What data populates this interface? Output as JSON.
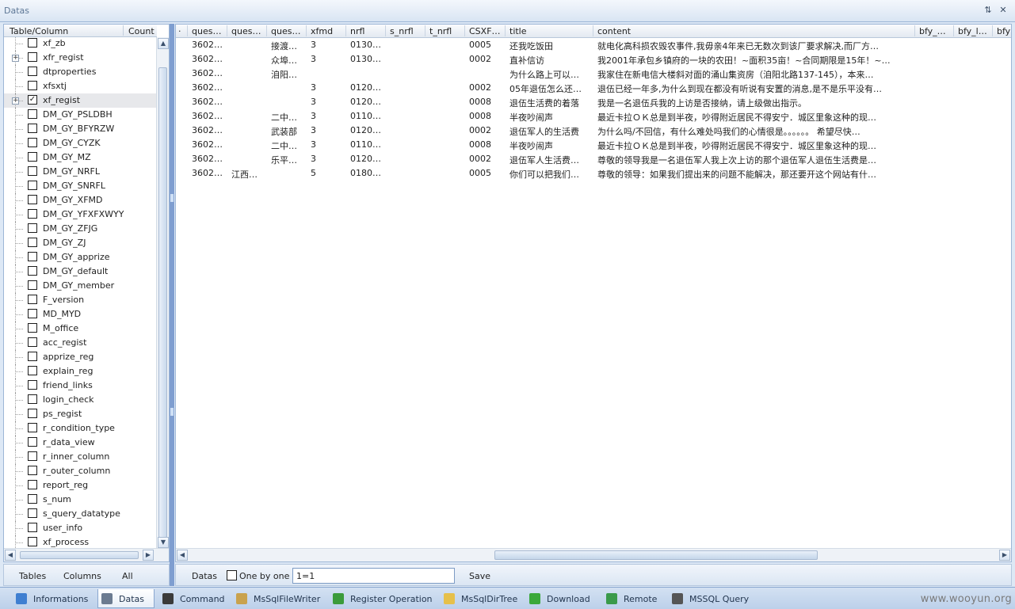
{
  "window": {
    "title": "Datas",
    "pin_icon": "pin-icon",
    "close_icon": "close-icon"
  },
  "tree": {
    "header_table": "Table/Column",
    "header_count": "Count",
    "items": [
      {
        "label": "xf_zb",
        "checked": false,
        "expandable": false
      },
      {
        "label": "xfr_regist",
        "checked": false,
        "expandable": true
      },
      {
        "label": "dtproperties",
        "checked": false,
        "expandable": false
      },
      {
        "label": "xfsxtj",
        "checked": false,
        "expandable": false
      },
      {
        "label": "xf_regist",
        "checked": true,
        "expandable": true,
        "selected": true
      },
      {
        "label": "DM_GY_PSLDBH",
        "checked": false,
        "expandable": false
      },
      {
        "label": "DM_GY_BFYRZW",
        "checked": false,
        "expandable": false
      },
      {
        "label": "DM_GY_CYZK",
        "checked": false,
        "expandable": false
      },
      {
        "label": "DM_GY_MZ",
        "checked": false,
        "expandable": false
      },
      {
        "label": "DM_GY_NRFL",
        "checked": false,
        "expandable": false
      },
      {
        "label": "DM_GY_SNRFL",
        "checked": false,
        "expandable": false
      },
      {
        "label": "DM_GY_XFMD",
        "checked": false,
        "expandable": false
      },
      {
        "label": "DM_GY_YFXFXWYY",
        "checked": false,
        "expandable": false
      },
      {
        "label": "DM_GY_ZFJG",
        "checked": false,
        "expandable": false
      },
      {
        "label": "DM_GY_ZJ",
        "checked": false,
        "expandable": false
      },
      {
        "label": "DM_GY_apprize",
        "checked": false,
        "expandable": false
      },
      {
        "label": "DM_GY_default",
        "checked": false,
        "expandable": false
      },
      {
        "label": "DM_GY_member",
        "checked": false,
        "expandable": false
      },
      {
        "label": "F_version",
        "checked": false,
        "expandable": false
      },
      {
        "label": "MD_MYD",
        "checked": false,
        "expandable": false
      },
      {
        "label": "M_office",
        "checked": false,
        "expandable": false
      },
      {
        "label": "acc_regist",
        "checked": false,
        "expandable": false
      },
      {
        "label": "apprize_reg",
        "checked": false,
        "expandable": false
      },
      {
        "label": "explain_reg",
        "checked": false,
        "expandable": false
      },
      {
        "label": "friend_links",
        "checked": false,
        "expandable": false
      },
      {
        "label": "login_check",
        "checked": false,
        "expandable": false
      },
      {
        "label": "ps_regist",
        "checked": false,
        "expandable": false
      },
      {
        "label": "r_condition_type",
        "checked": false,
        "expandable": false
      },
      {
        "label": "r_data_view",
        "checked": false,
        "expandable": false
      },
      {
        "label": "r_inner_column",
        "checked": false,
        "expandable": false
      },
      {
        "label": "r_outer_column",
        "checked": false,
        "expandable": false
      },
      {
        "label": "report_reg",
        "checked": false,
        "expandable": false
      },
      {
        "label": "s_num",
        "checked": false,
        "expandable": false
      },
      {
        "label": "s_query_datatype",
        "checked": false,
        "expandable": false
      },
      {
        "label": "user_info",
        "checked": false,
        "expandable": false
      },
      {
        "label": "xf_process",
        "checked": false,
        "expandable": false
      }
    ]
  },
  "grid": {
    "columns": [
      "ques…",
      "ques…",
      "ques…",
      "xfmd",
      "nrfl",
      "s_nrfl",
      "t_nrfl",
      "CSXF…",
      "title",
      "content",
      "bfy_…",
      "bfy_l…",
      "bfy"
    ],
    "rows": [
      [
        "3602…",
        "",
        "接渡…",
        "3",
        "0130…",
        "",
        "",
        "0005",
        "还我吃饭田",
        "  就电化高科损农毁农事件,我毋亲4年来已无数次到该厂要求解决,而厂方…"
      ],
      [
        "3602…",
        "",
        "众埠…",
        "3",
        "0130…",
        "",
        "",
        "0002",
        "直补信访",
        "我2001年承包乡镇府的一块的农田！~面积35亩！~合同期限是15年！~…"
      ],
      [
        "3602…",
        "",
        "洎阳…",
        "",
        "",
        "",
        "",
        "",
        "为什么路上可以…",
        "  我家住在新电信大楼斜对面的涌山集资房（洎阳北路137-145），本来…"
      ],
      [
        "3602…",
        "",
        "",
        "3",
        "0120…",
        "",
        "",
        "0002",
        "05年退伍怎么还…",
        "退伍已经一年多,为什么到现在都没有听说有安置的消息,是不是乐平没有…"
      ],
      [
        "3602…",
        "",
        "",
        "3",
        "0120…",
        "",
        "",
        "0008",
        "退伍生活费的着落",
        "我是一名退伍兵我的上访是否接纳，请上级做出指示。"
      ],
      [
        "3602…",
        "",
        "二中…",
        "3",
        "0110…",
        "",
        "",
        "0008",
        "半夜吵闹声",
        "最近卡拉ＯＫ总是到半夜，吵得附近居民不得安宁．城区里象这种的现…"
      ],
      [
        "3602…",
        "",
        "武装部",
        "3",
        "0120…",
        "",
        "",
        "0002",
        "退伍军人的生活费",
        "为什么吗/不回信，有什么难处吗我们的心情很是。。。。。。 希望尽快…"
      ],
      [
        "3602…",
        "",
        "二中…",
        "3",
        "0110…",
        "",
        "",
        "0008",
        "半夜吵闹声",
        "最近卡拉ＯＫ总是到半夜，吵得附近居民不得安宁．城区里象这种的现…"
      ],
      [
        "3602…",
        "",
        "乐平…",
        "3",
        "0120…",
        "",
        "",
        "0002",
        "退伍军人生活费…",
        "尊敬的领导我是一名退伍军人我上次上访的那个退伍军人退伍生活费是…"
      ],
      [
        "3602…",
        "江西…",
        "",
        "5",
        "0180…",
        "",
        "",
        "0005",
        "你们可以把我们…",
        "尊敬的领导：如果我们提出来的问题不能解决，那还要开这个网站有什…"
      ]
    ]
  },
  "left_toolbar": {
    "tables": "Tables",
    "columns": "Columns",
    "all": "All"
  },
  "grid_toolbar": {
    "datas": "Datas",
    "one_by_one": "One by one",
    "filter_value": "1=1",
    "save": "Save"
  },
  "bottom_tabs": [
    {
      "label": "Informations",
      "icon": "info-icon",
      "color": "#3f7fd1"
    },
    {
      "label": "Datas",
      "icon": "database-icon",
      "color": "#6b7b90",
      "active": true
    },
    {
      "label": "Command",
      "icon": "terminal-icon",
      "color": "#3a3a3a"
    },
    {
      "label": "MsSqlFileWriter",
      "icon": "file-write-icon",
      "color": "#c9a24d"
    },
    {
      "label": "Register Operation",
      "icon": "registry-icon",
      "color": "#3b9b3b"
    },
    {
      "label": "MsSqlDirTree",
      "icon": "folder-icon",
      "color": "#e6c04a"
    },
    {
      "label": "Download",
      "icon": "download-icon",
      "color": "#3aa83a"
    },
    {
      "label": "Remote",
      "icon": "globe-icon",
      "color": "#3a9a4a"
    },
    {
      "label": "MSSQL Query",
      "icon": "sql-icon",
      "color": "#555555"
    }
  ],
  "watermark": "www.wooyun.org"
}
